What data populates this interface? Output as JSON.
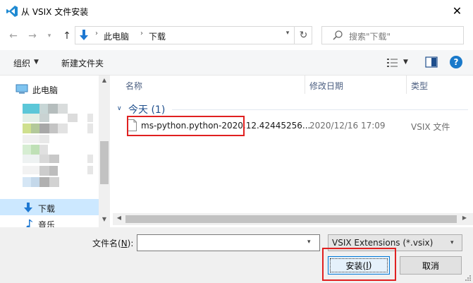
{
  "window": {
    "title": "从 VSIX 文件安装",
    "close_symbol": "✕"
  },
  "nav": {
    "back_symbol": "←",
    "forward_symbol": "→",
    "recent_symbol": "▾",
    "up_symbol": "↑",
    "breadcrumb": [
      "此电脑",
      "下载"
    ],
    "breadcrumb_separator": "›",
    "dropdown_symbol": "▾",
    "refresh_symbol": "↻",
    "search_placeholder": "搜索\"下载\""
  },
  "toolbar": {
    "organize_label": "组织",
    "new_folder_label": "新建文件夹",
    "caret_symbol": "▼",
    "help_symbol": "?"
  },
  "nav_pane": {
    "this_pc_label": "此电脑",
    "downloads_label": "下载",
    "music_label": "音乐",
    "scroll_up": "▲",
    "scroll_down": "▼"
  },
  "file_list": {
    "columns": [
      "名称",
      "修改日期",
      "类型"
    ],
    "group": {
      "toggle_symbol": "∨",
      "title": "今天 (1)"
    },
    "rows": [
      {
        "name": "ms-python.python-2020.12.42445256...",
        "date": "2020/12/16 17:09",
        "type": "VSIX 文件"
      }
    ],
    "scroll_left": "◀",
    "scroll_right": "▶"
  },
  "bottom": {
    "filename_label": "文件名(N):",
    "filename_label_prefix": "文件名(",
    "filename_label_key": "N",
    "filename_label_suffix": "):",
    "filename_value": "",
    "filetype_selected": "VSIX Extensions (*.vsix)",
    "install_prefix": "安装(",
    "install_key": "I",
    "install_suffix": ")",
    "cancel_label": "取消"
  },
  "colors": {
    "accent": "#0078d7",
    "highlight_box": "#e02020",
    "selection": "#cce8ff",
    "vscode_blue": "#1f8ad2"
  }
}
